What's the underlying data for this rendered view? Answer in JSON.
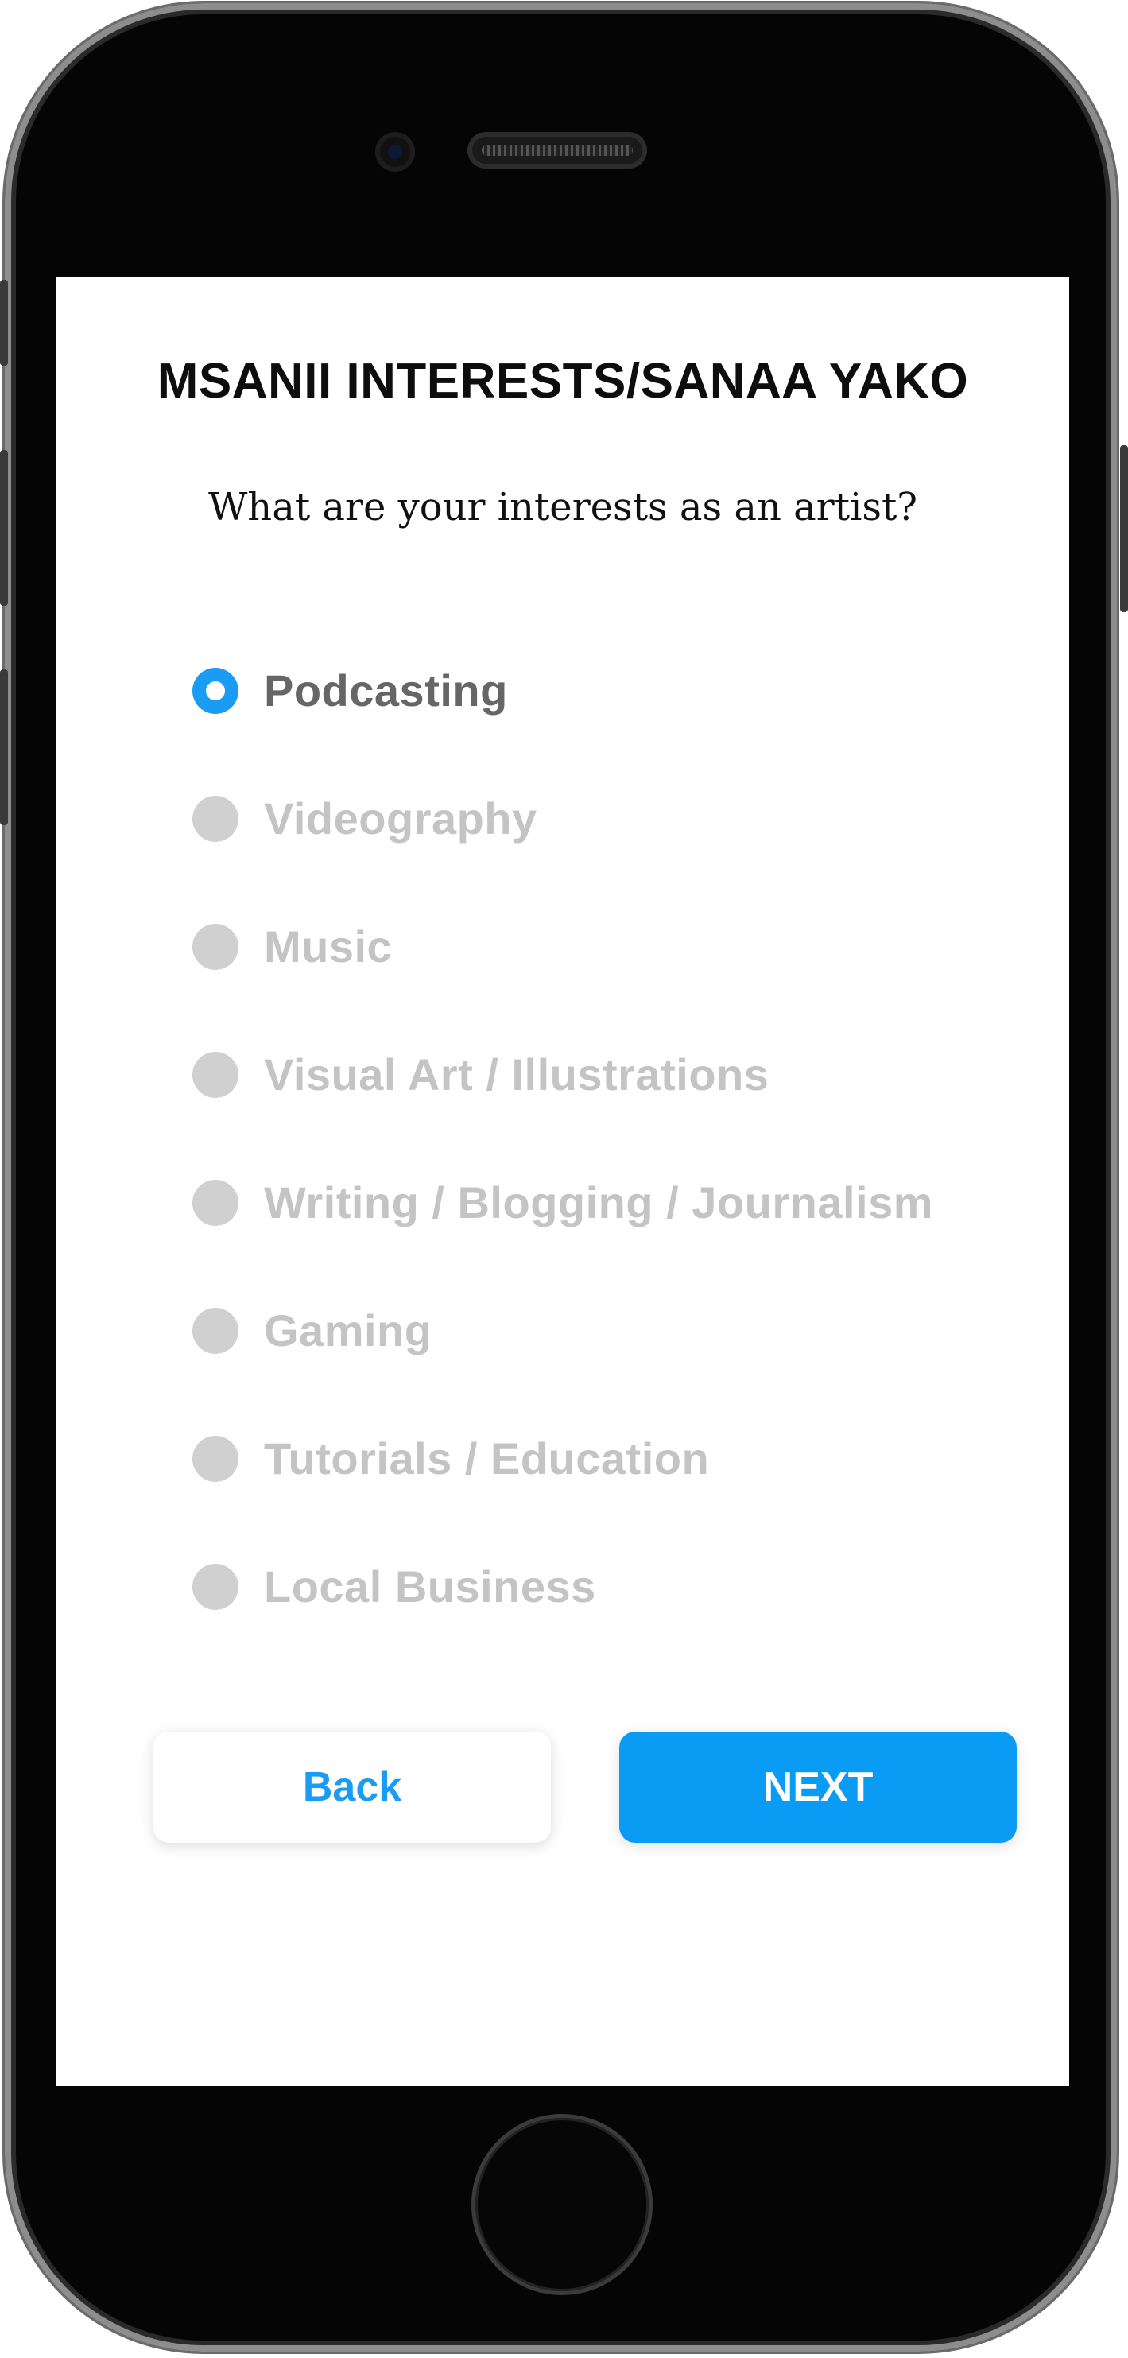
{
  "header": {
    "title": "MSANII INTERESTS/SANAA YAKO",
    "question": "What are your interests as an artist?"
  },
  "interests": [
    {
      "label": "Podcasting",
      "selected": true
    },
    {
      "label": "Videography",
      "selected": false
    },
    {
      "label": "Music",
      "selected": false
    },
    {
      "label": "Visual Art / Illustrations",
      "selected": false
    },
    {
      "label": "Writing / Blogging / Journalism",
      "selected": false
    },
    {
      "label": "Gaming",
      "selected": false
    },
    {
      "label": "Tutorials / Education",
      "selected": false
    },
    {
      "label": "Local Business",
      "selected": false
    }
  ],
  "buttons": {
    "back_label": "Back",
    "next_label": "NEXT"
  },
  "colors": {
    "accent": "#0a9bf5",
    "selected_text": "#666666",
    "unselected_text": "#c4c4c4",
    "unselected_radio": "#d0d0d0",
    "device_frame": "#050505"
  },
  "icons": {
    "selected_radio": "radio-selected-icon",
    "unselected_radio": "radio-unselected-icon",
    "camera": "front-camera-icon",
    "speaker": "earpiece-speaker-icon",
    "home": "home-button-icon"
  }
}
